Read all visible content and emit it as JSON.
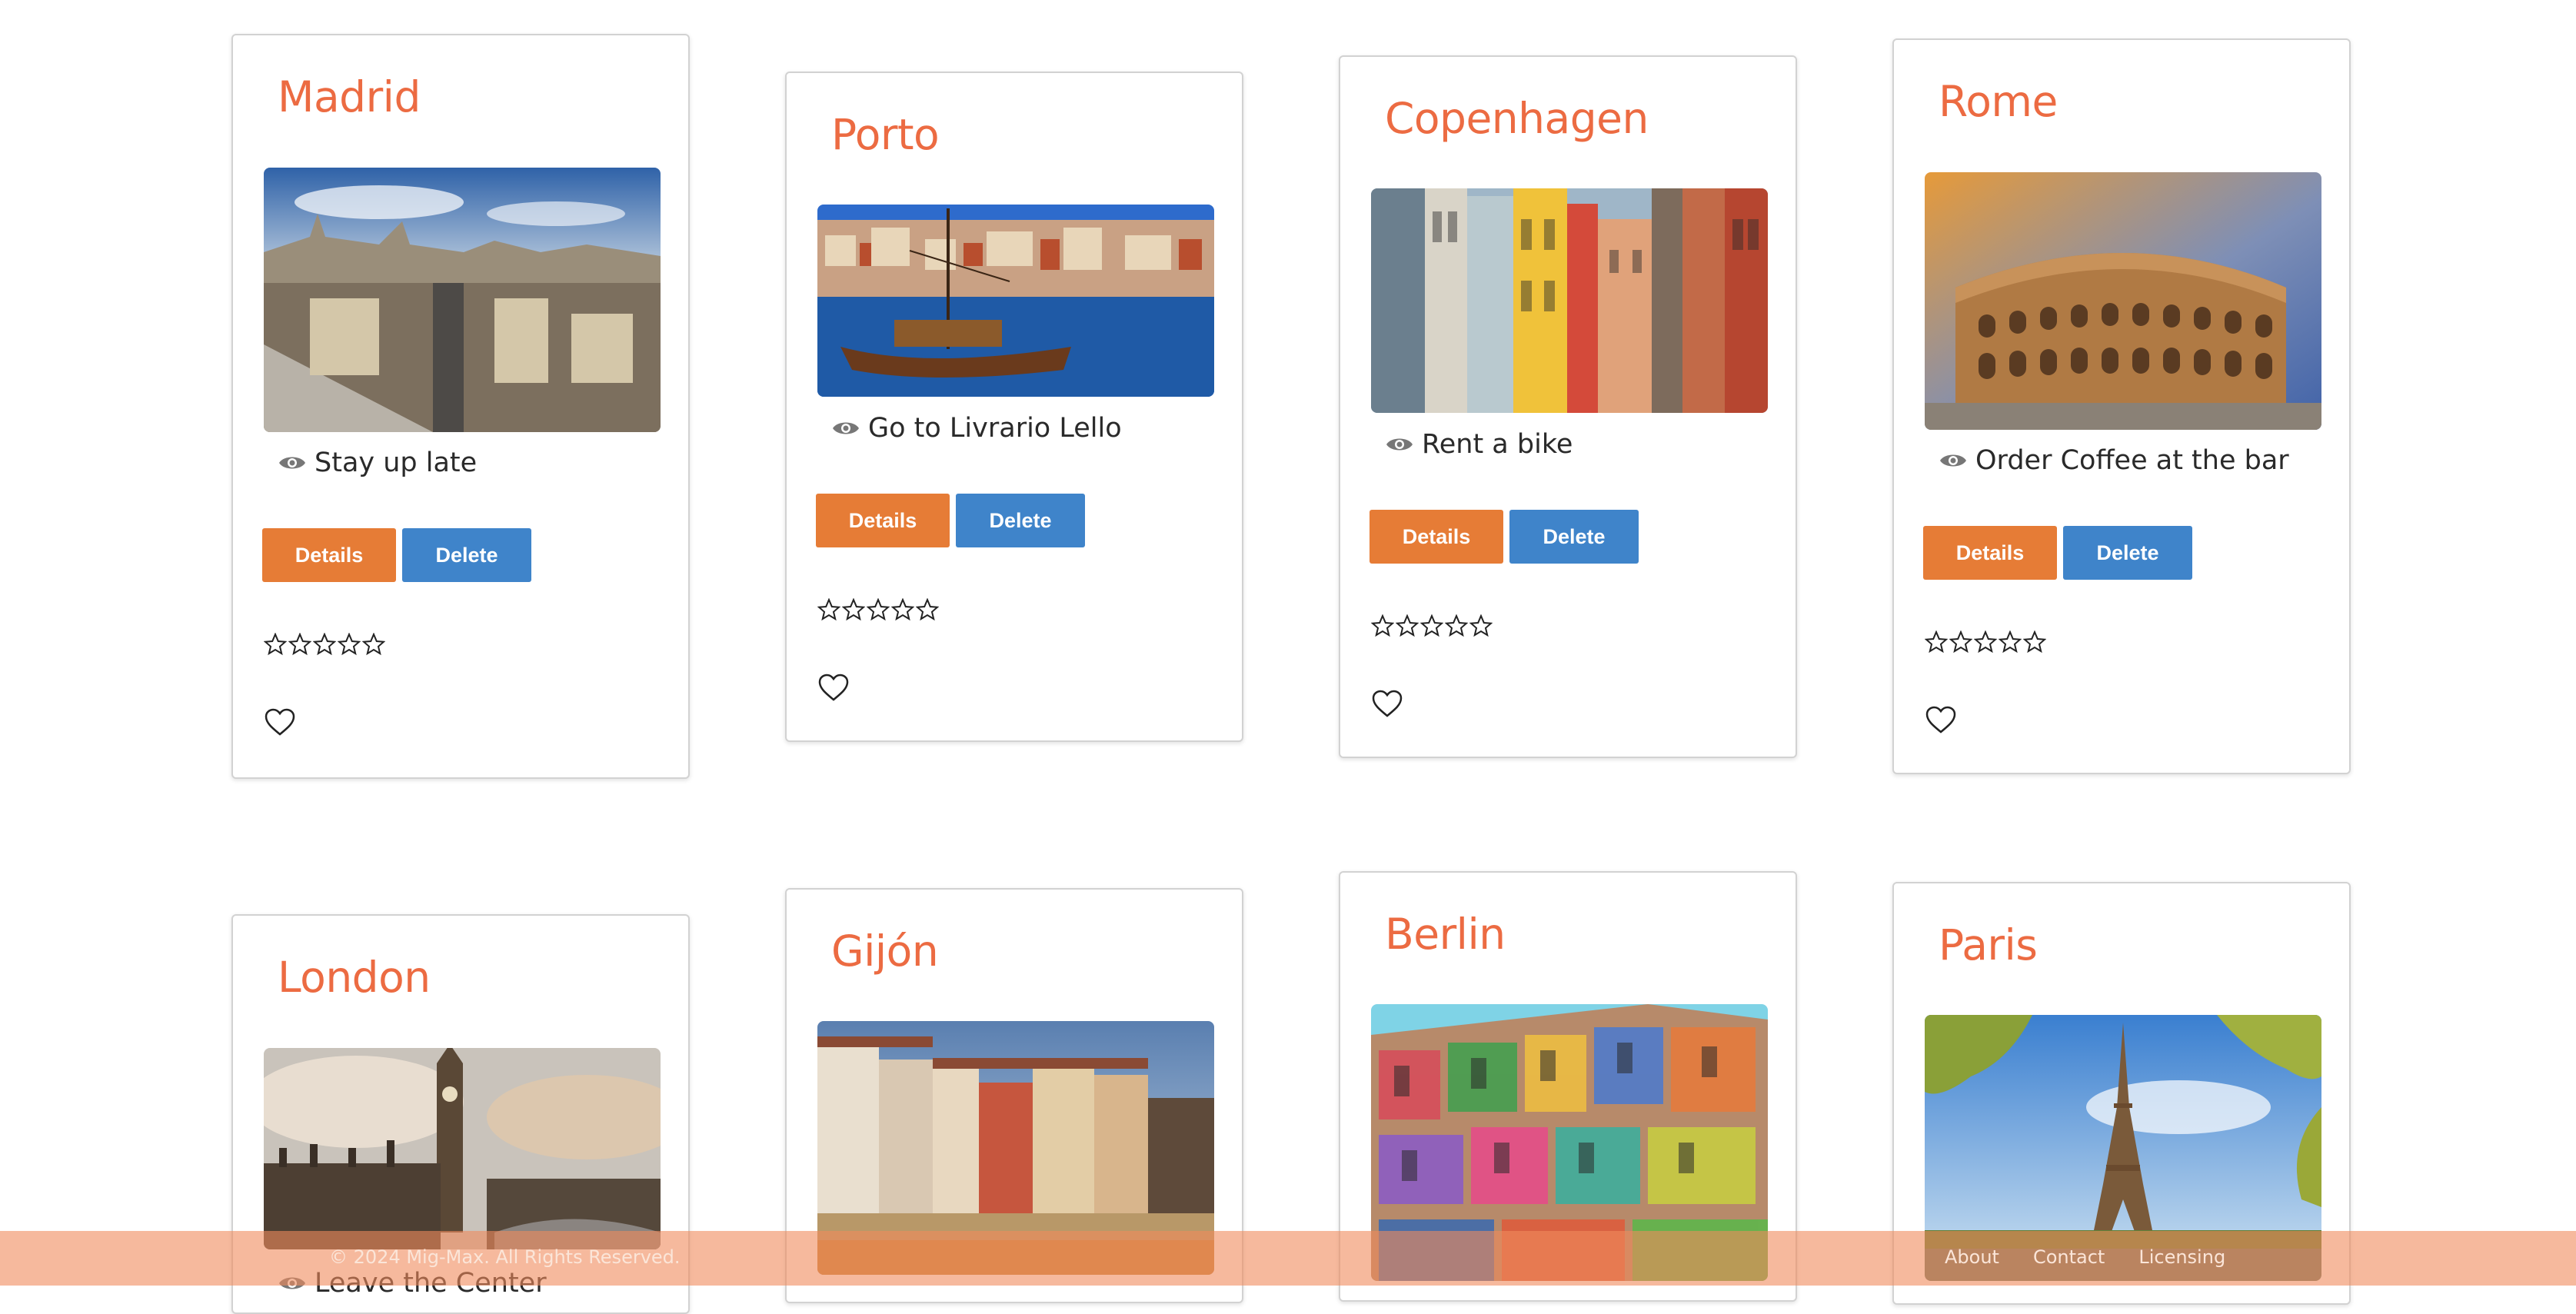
{
  "theme": {
    "title_color": "#ec6b42",
    "details_color": "#e67c36",
    "delete_color": "#3f84ca",
    "footer_text_color": "#fbe5d8"
  },
  "cards": [
    {
      "name": "Madrid",
      "activity": "Stay up late",
      "details_label": "Details",
      "delete_label": "Delete",
      "rating": 0,
      "liked": false,
      "image": "madrid-cityscape-photo"
    },
    {
      "name": "Porto",
      "activity": "Go to Livrario Lello",
      "details_label": "Details",
      "delete_label": "Delete",
      "rating": 0,
      "liked": false,
      "image": "porto-river-boat-photo"
    },
    {
      "name": "Copenhagen",
      "activity": "Rent a bike",
      "details_label": "Details",
      "delete_label": "Delete",
      "rating": 0,
      "liked": false,
      "image": "copenhagen-colorful-houses-photo"
    },
    {
      "name": "Rome",
      "activity": "Order Coffee at the bar",
      "details_label": "Details",
      "delete_label": "Delete",
      "rating": 0,
      "liked": false,
      "image": "rome-colosseum-photo"
    },
    {
      "name": "London",
      "activity": "Leave the Center",
      "image": "london-big-ben-photo"
    },
    {
      "name": "Gijón",
      "image": "gijon-harbor-houses-photo"
    },
    {
      "name": "Berlin",
      "image": "berlin-graffiti-building-photo"
    },
    {
      "name": "Paris",
      "image": "paris-eiffel-tower-photo"
    }
  ],
  "footer": {
    "copyright": "© 2024 Mig-Max. All Rights Reserved.",
    "links": [
      "About",
      "Contact",
      "Licensing"
    ]
  }
}
